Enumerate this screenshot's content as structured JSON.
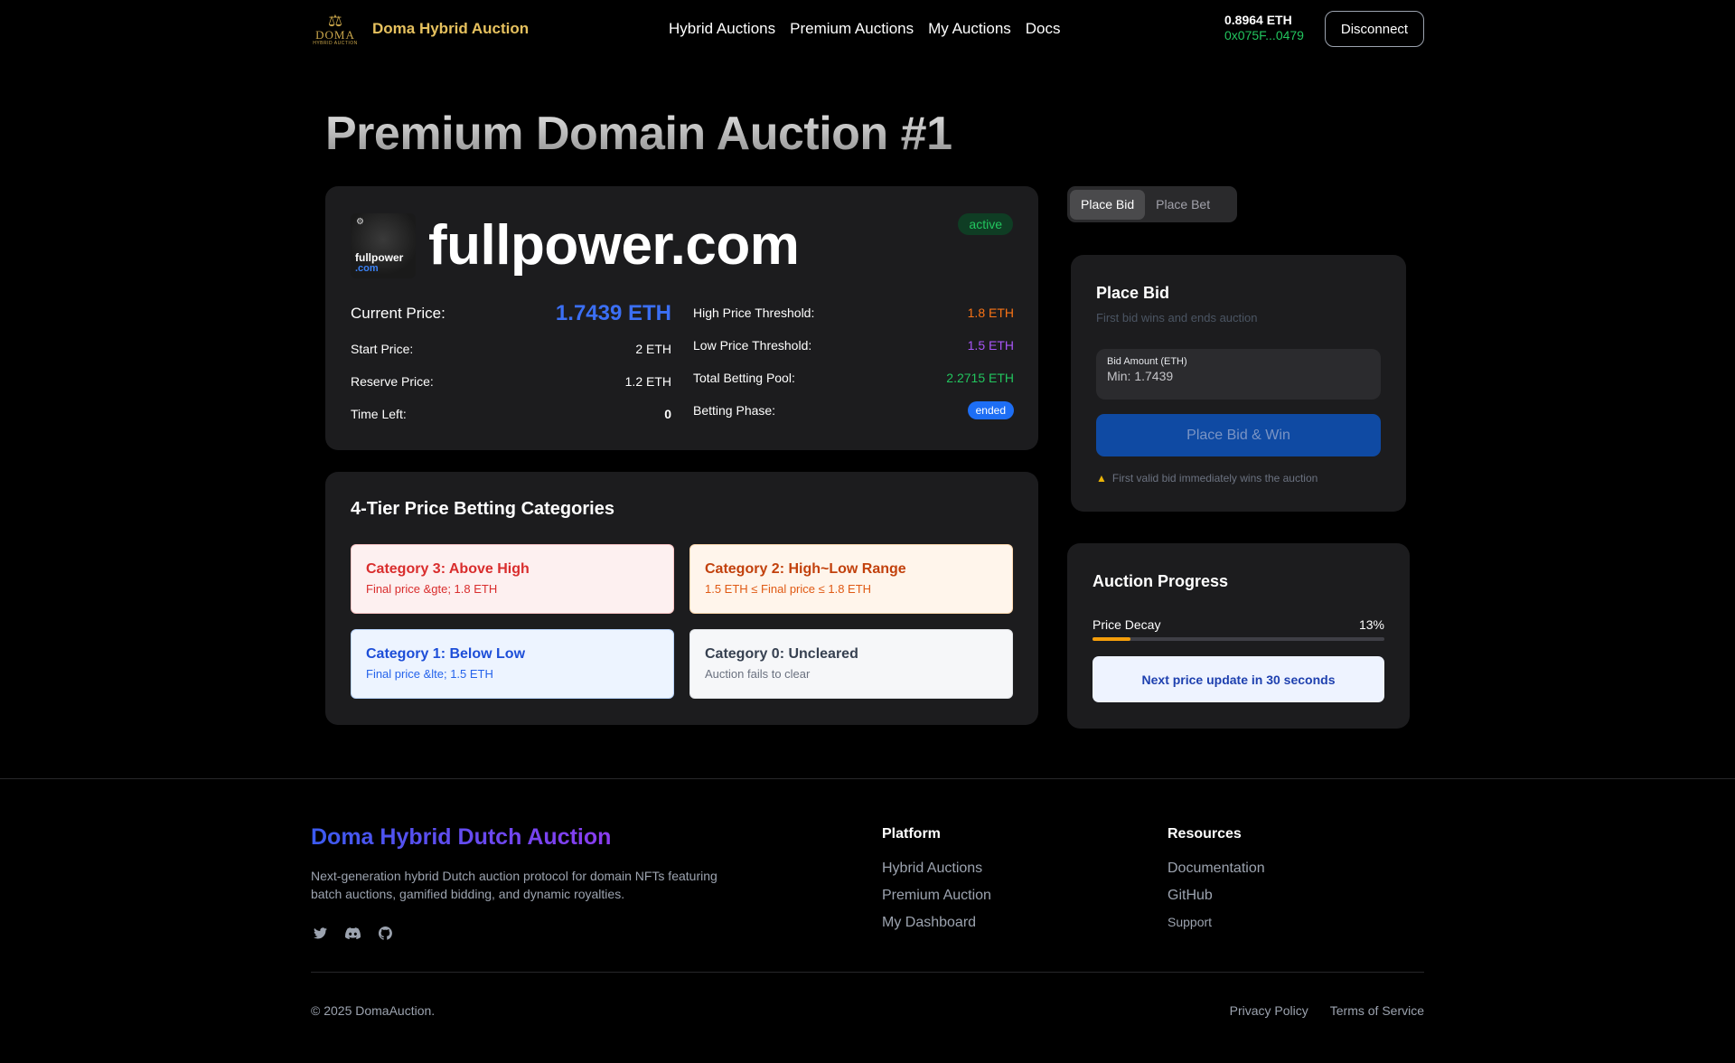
{
  "nav": {
    "logo_text": "DOMA",
    "logo_subtext": "HYBRID AUCTION",
    "brand": "Doma Hybrid Auction",
    "links": [
      "Hybrid Auctions",
      "Premium Auctions",
      "My Auctions",
      "Docs"
    ],
    "balance": "0.8964 ETH",
    "address": "0x075F...0479",
    "disconnect_label": "Disconnect"
  },
  "page_title": "Premium Domain Auction #1",
  "domain": {
    "thumb_top": "fullpower",
    "thumb_bottom": ".com",
    "name": "fullpower.com",
    "status": "active",
    "current_price_label": "Current Price:",
    "current_price": "1.7439 ETH",
    "start_price_label": "Start Price:",
    "start_price": "2 ETH",
    "reserve_price_label": "Reserve Price:",
    "reserve_price": "1.2 ETH",
    "time_left_label": "Time Left:",
    "time_left": "0",
    "high_threshold_label": "High Price Threshold:",
    "high_threshold": "1.8 ETH",
    "low_threshold_label": "Low Price Threshold:",
    "low_threshold": "1.5 ETH",
    "betting_pool_label": "Total Betting Pool:",
    "betting_pool": "2.2715 ETH",
    "betting_phase_label": "Betting Phase:",
    "betting_phase": "ended"
  },
  "betting": {
    "title": "4-Tier Price Betting Categories",
    "categories": [
      {
        "title": "Category 3: Above High",
        "subtitle": "Final price &gte; 1.8 ETH"
      },
      {
        "title": "Category 2: High~Low Range",
        "subtitle": "1.5 ETH ≤ Final price ≤ 1.8 ETH"
      },
      {
        "title": "Category 1: Below Low",
        "subtitle": "Final price &lte; 1.5 ETH"
      },
      {
        "title": "Category 0: Uncleared",
        "subtitle": "Auction fails to clear"
      }
    ]
  },
  "tabs": [
    "Place Bid",
    "Place Bet"
  ],
  "bid": {
    "title": "Place Bid",
    "subtitle": "First bid wins and ends auction",
    "amount_label": "Bid Amount (ETH)",
    "amount_placeholder": "Min: 1.7439",
    "button_label": "Place Bid & Win",
    "warning": "First valid bid immediately wins the auction"
  },
  "progress": {
    "title": "Auction Progress",
    "label": "Price Decay",
    "percent_text": "13%",
    "percent": 13,
    "fill_color": "#f59e0b",
    "next_update": "Next price update in 30 seconds"
  },
  "footer": {
    "brand": "Doma Hybrid Dutch Auction",
    "description": "Next-generation hybrid Dutch auction protocol for domain NFTs featuring batch auctions, gamified bidding, and dynamic royalties.",
    "socials": [
      "twitter-icon",
      "discord-icon",
      "github-icon"
    ],
    "platform_title": "Platform",
    "platform_links": [
      "Hybrid Auctions",
      "Premium Auction",
      "My Dashboard"
    ],
    "resources_title": "Resources",
    "resources_links": [
      "Documentation",
      "GitHub",
      "Support"
    ],
    "copyright": "© 2025 DomaAuction.",
    "privacy": "Privacy Policy",
    "terms": "Terms of Service"
  }
}
